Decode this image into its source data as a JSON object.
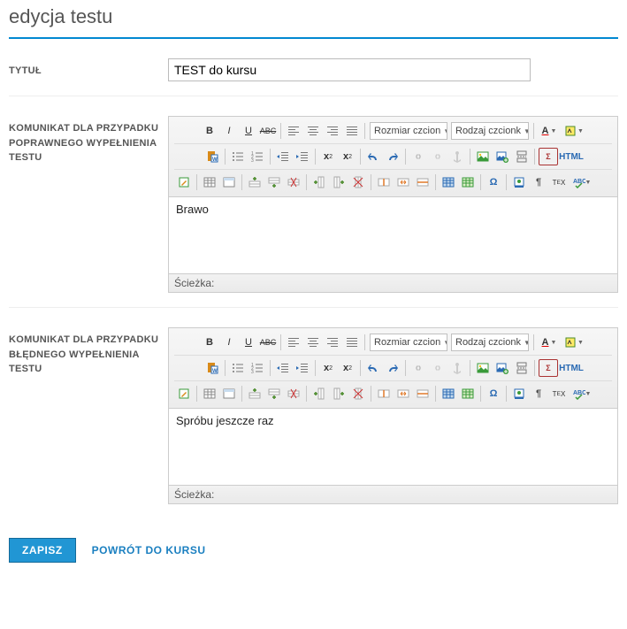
{
  "page": {
    "title": "edycja testu"
  },
  "labels": {
    "title": "TYTUŁ",
    "msg_ok": "KOMUNIKAT DLA PRZYPADKU POPRAWNEGO WYPEŁNIENIA TESTU",
    "msg_bad": "KOMUNIKAT DLA PRZYPADKU BŁĘDNEGO WYPEŁNIENIA TESTU"
  },
  "fields": {
    "title_value": "TEST do kursu"
  },
  "rte": {
    "font_size_dd": "Rozmiar czcion",
    "font_family_dd": "Rodzaj czcionk",
    "html_label": "HTML",
    "path_label": "Ścieżka:"
  },
  "editor_ok": {
    "content": "Brawo"
  },
  "editor_bad": {
    "content": "Spróbu jeszcze raz"
  },
  "actions": {
    "save": "ZAPISZ",
    "back": "POWRÓT DO KURSU"
  }
}
